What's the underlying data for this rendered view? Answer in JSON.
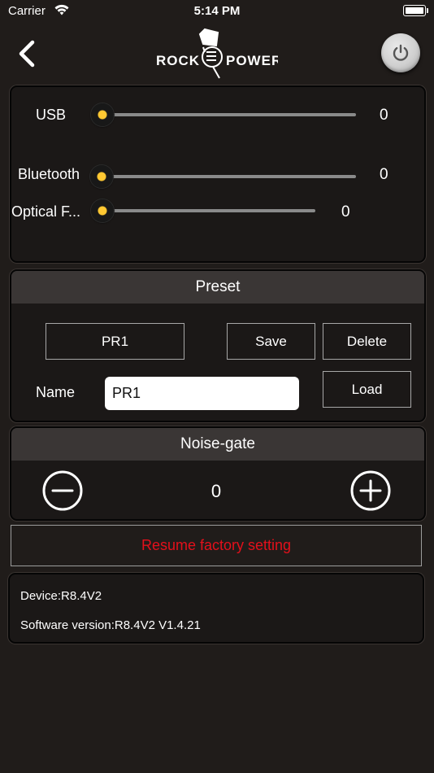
{
  "status_bar": {
    "carrier": "Carrier",
    "time": "5:14 PM"
  },
  "nav": {
    "logo_text": "ROCKPOWER"
  },
  "volume": {
    "sliders": [
      {
        "label": "USB",
        "value": "0"
      },
      {
        "label": "Bluetooth",
        "value": "0"
      },
      {
        "label": "Optical F...",
        "value": "0"
      }
    ]
  },
  "preset": {
    "title": "Preset",
    "selected": "PR1",
    "save_label": "Save",
    "delete_label": "Delete",
    "name_label": "Name",
    "name_value": "PR1",
    "load_label": "Load"
  },
  "noise_gate": {
    "title": "Noise-gate",
    "value": "0"
  },
  "factory": {
    "label": "Resume factory setting",
    "color": "#e3101b"
  },
  "device_info": {
    "device": "Device:R8.4V2",
    "software": "Software version:R8.4V2 V1.4.21"
  },
  "colors": {
    "background": "#201c1a",
    "knob_accent": "#ffc832",
    "header": "#3a3635"
  }
}
